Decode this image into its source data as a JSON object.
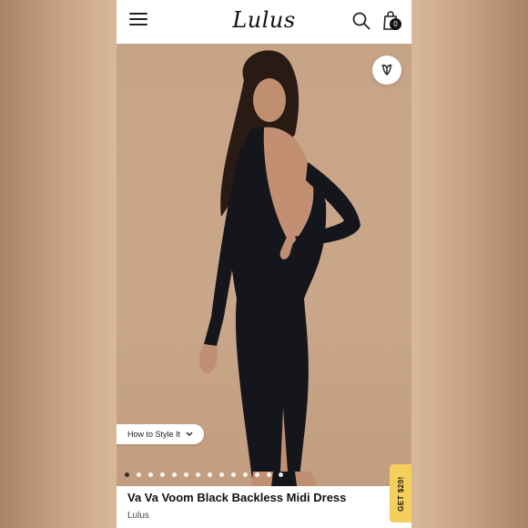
{
  "header": {
    "logo_text": "Lulus",
    "bag_count": "0",
    "icons": [
      "hamburger-menu-icon",
      "search-icon",
      "shopping-bag-icon"
    ]
  },
  "hero": {
    "favorite_icon": "heart-icon",
    "style_button_label": "How to Style It",
    "carousel_dots": 14,
    "active_dot_index": 0
  },
  "promo": {
    "label": "GET $20!"
  },
  "product": {
    "title": "Va Va Voom Black Backless Midi Dress",
    "brand": "Lulus"
  },
  "colors": {
    "accent_yellow": "#f4cf5b",
    "backdrop": "#c8a487",
    "dress": "#15161c"
  }
}
